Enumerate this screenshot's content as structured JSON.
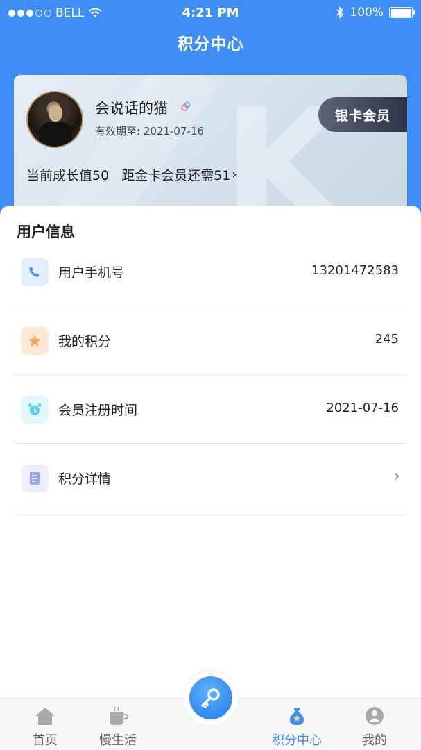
{
  "status_bar": {
    "carrier": "BELL",
    "time": "4:21 PM",
    "battery": "100%"
  },
  "nav": {
    "title": "积分中心"
  },
  "member_card": {
    "username": "会说话的猫",
    "expire_label": "有效期至:",
    "expire_date": "2021-07-16",
    "growth_text": "当前成长值50",
    "upgrade_text": "距金卡会员还需51",
    "level_badge": "银卡会员",
    "watermark_glyph": "K"
  },
  "user_info": {
    "title": "用户信息",
    "rows": [
      {
        "label": "用户手机号",
        "value": "13201472583",
        "icon": "phone-icon",
        "color": "#4a8ff0"
      },
      {
        "label": "我的积分",
        "value": "245",
        "icon": "star-icon",
        "color": "#f4a55c"
      },
      {
        "label": "会员注册时间",
        "value": "2021-07-16",
        "icon": "alarm-clock-icon",
        "color": "#5fd0e8"
      },
      {
        "label": "积分详情",
        "value": "",
        "icon": "document-icon",
        "color": "#9aa6f0"
      }
    ]
  },
  "tabbar": {
    "items": [
      {
        "label": "首页",
        "icon": "home-icon"
      },
      {
        "label": "慢生活",
        "icon": "coffee-cup-icon"
      },
      {
        "label": "积分中心",
        "icon": "money-bag-icon"
      },
      {
        "label": "我的",
        "icon": "person-icon"
      }
    ],
    "center_icon": "key-icon",
    "accent": "#3f8ef5"
  }
}
